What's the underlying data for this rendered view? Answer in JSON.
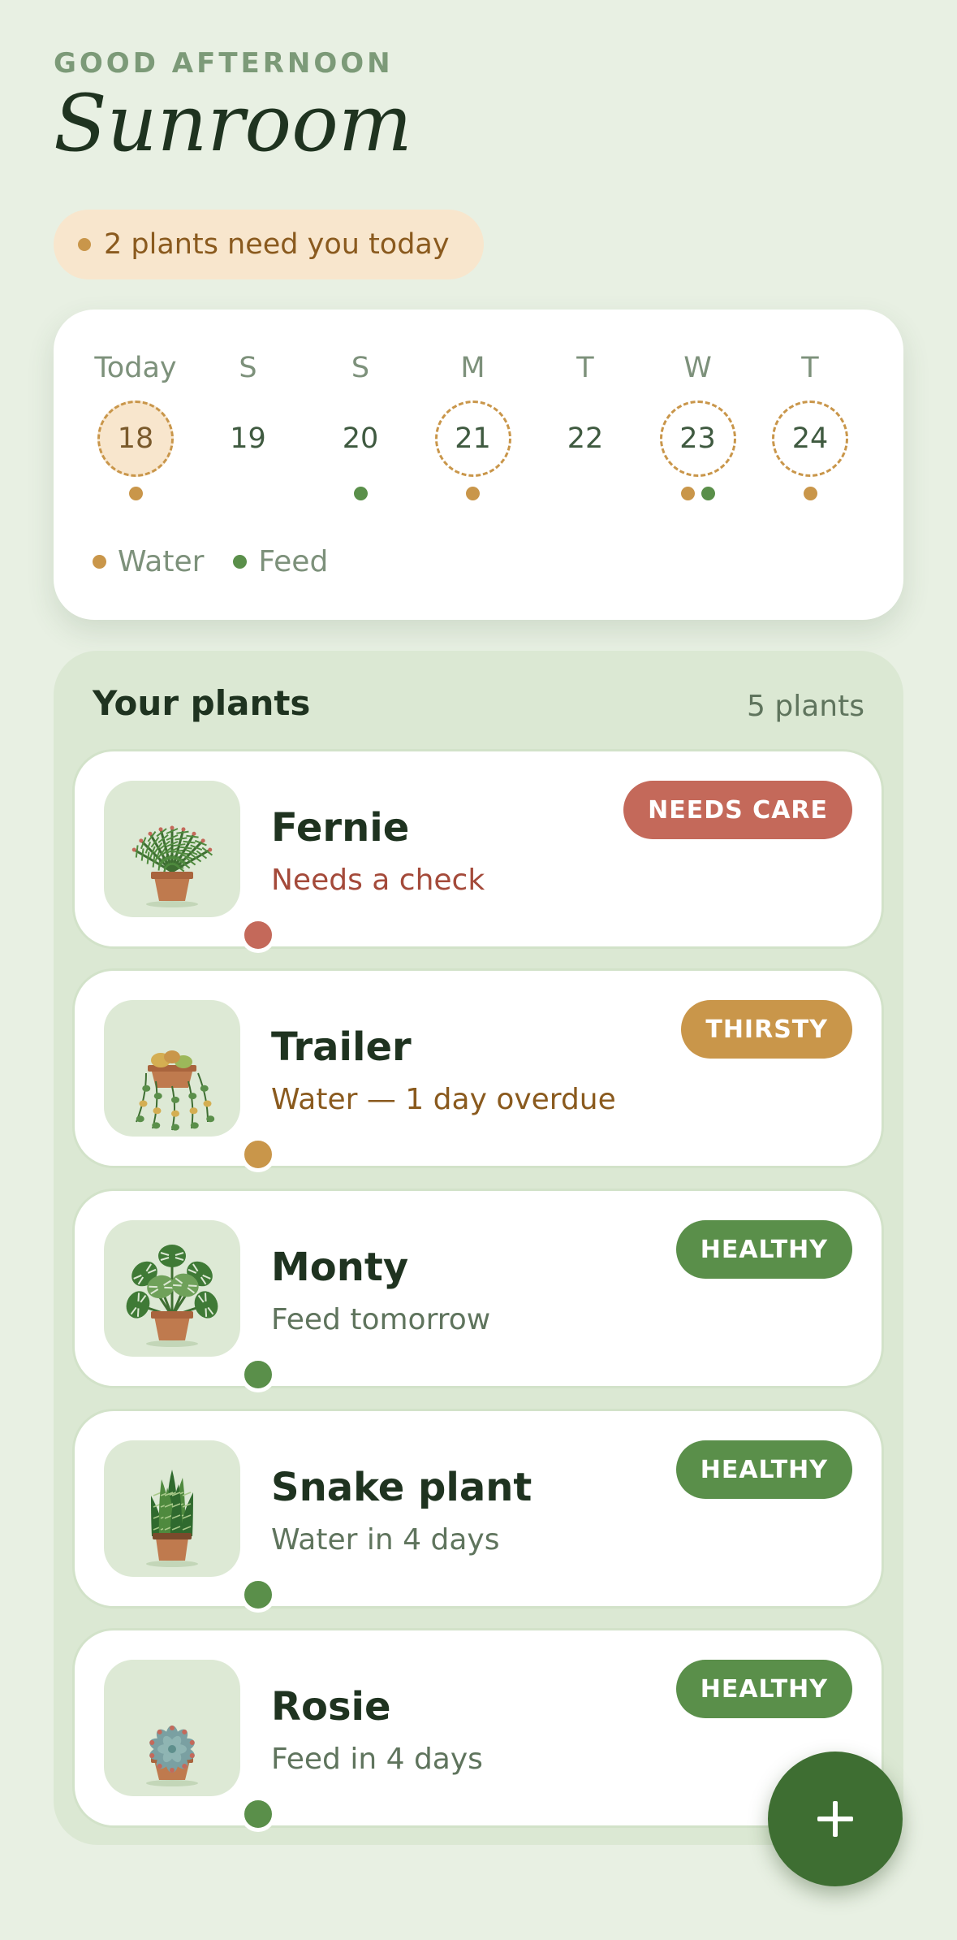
{
  "header": {
    "greeting": "GOOD AFTERNOON",
    "title": "Sunroom"
  },
  "alert": {
    "text": "2 plants need you today"
  },
  "calendar": {
    "days": [
      {
        "name": "Today",
        "num": "18",
        "events": [
          "water"
        ],
        "today": true,
        "ring": true
      },
      {
        "name": "S",
        "num": "19",
        "events": [],
        "today": false,
        "ring": false
      },
      {
        "name": "S",
        "num": "20",
        "events": [
          "feed"
        ],
        "today": false,
        "ring": false
      },
      {
        "name": "M",
        "num": "21",
        "events": [
          "water"
        ],
        "today": false,
        "ring": true
      },
      {
        "name": "T",
        "num": "22",
        "events": [],
        "today": false,
        "ring": false
      },
      {
        "name": "W",
        "num": "23",
        "events": [
          "water",
          "feed"
        ],
        "today": false,
        "ring": true
      },
      {
        "name": "T",
        "num": "24",
        "events": [
          "water"
        ],
        "today": false,
        "ring": true
      }
    ],
    "legend": {
      "water": "Water",
      "feed": "Feed"
    }
  },
  "plants_panel": {
    "title": "Your plants",
    "count": "5 plants",
    "plants": [
      {
        "name": "Fernie",
        "status": "Needs a check",
        "badge": "NEEDS CARE",
        "badge_color": "#c4695a",
        "status_color": "#a44a3a",
        "dot_color": "#c4695a",
        "icon": "fern-plant-icon"
      },
      {
        "name": "Trailer",
        "status": "Water — 1 day overdue",
        "badge": "THIRSTY",
        "badge_color": "#c9964a",
        "status_color": "#8a5a1e",
        "dot_color": "#c9964a",
        "icon": "trailing-plant-icon"
      },
      {
        "name": "Monty",
        "status": "Feed tomorrow",
        "badge": "HEALTHY",
        "badge_color": "#5a8f4a",
        "status_color": "#5f745d",
        "dot_color": "#5a8f4a",
        "icon": "monstera-plant-icon"
      },
      {
        "name": "Snake plant",
        "status": "Water in 4 days",
        "badge": "HEALTHY",
        "badge_color": "#5a8f4a",
        "status_color": "#5f745d",
        "dot_color": "#5a8f4a",
        "icon": "snake-plant-icon"
      },
      {
        "name": "Rosie",
        "status": "Feed in 4 days",
        "badge": "HEALTHY",
        "badge_color": "#5a8f4a",
        "status_color": "#5f745d",
        "dot_color": "#5a8f4a",
        "icon": "succulent-plant-icon"
      }
    ]
  },
  "fab": {
    "icon": "plus-icon"
  },
  "colors": {
    "water": "#c9964a",
    "feed": "#5a8f4a",
    "accent": "#3e6e32"
  }
}
